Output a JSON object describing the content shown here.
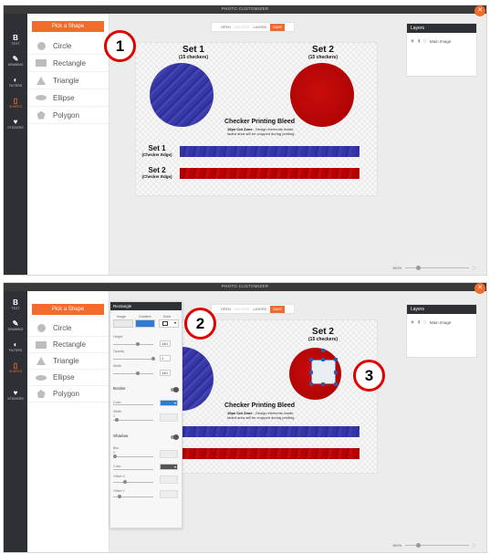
{
  "app": {
    "title": "PHOTO CUSTOMIZER"
  },
  "sidebar": {
    "items": [
      {
        "glyph": "B",
        "label": "TEXT"
      },
      {
        "glyph": "✎",
        "label": "DRAWING"
      },
      {
        "glyph": "◐",
        "label": "FILTERS"
      },
      {
        "glyph": "▯",
        "label": "SHAPES"
      },
      {
        "glyph": "♥",
        "label": "STICKERS"
      }
    ]
  },
  "shapes_panel": {
    "button": "Pick a Shape",
    "items": [
      "Circle",
      "Rectangle",
      "Triangle",
      "Ellipse",
      "Polygon"
    ]
  },
  "topbar": {
    "open": "OPEN",
    "history": "HISTORY",
    "layers": "LAYERS",
    "save": "SAVE"
  },
  "canvas": {
    "set1": {
      "title": "Set 1",
      "sub": "(15 checkers)"
    },
    "set2": {
      "title": "Set 2",
      "sub": "(15 checkers)"
    },
    "bleed": {
      "title": "Checker Printing Bleed",
      "line1_bold": "10px Cut Zone",
      "line1": " - Design elements inside",
      "line2": "faded area will be cropped during printing."
    },
    "edge1": {
      "title": "Set 1",
      "sub": "(Checker Edge)"
    },
    "edge2": {
      "title": "Set 2",
      "sub": "(Checker Edge)"
    }
  },
  "layers": {
    "header": "Layers",
    "row": "Main Image",
    "icons": [
      "eye-icon",
      "lock-icon",
      "trash-icon"
    ]
  },
  "zoom": {
    "value": "150%"
  },
  "callouts": [
    "1",
    "2",
    "3"
  ],
  "props": {
    "title": "Rectangle",
    "tabs": [
      "Image",
      "Gradient",
      "Solid"
    ],
    "height_label": "Height",
    "height_value": "140",
    "opacity_label": "Opacity",
    "opacity_value": "1",
    "width_label": "Width",
    "width_value": "140",
    "border_label": "Border",
    "border_color_label": "Color",
    "border_width_label": "Width",
    "border_width_value": "1",
    "shadow_label": "Shadow",
    "blur_label": "Blur",
    "blur_value": "0",
    "shadow_color_label": "Color",
    "offsetx_label": "Offset X",
    "offsety_label": "Offset Y",
    "colors": {
      "accent": "#f26b2a",
      "border_swatch": "#2f7ad6",
      "shadow_swatch": "#555555"
    }
  }
}
